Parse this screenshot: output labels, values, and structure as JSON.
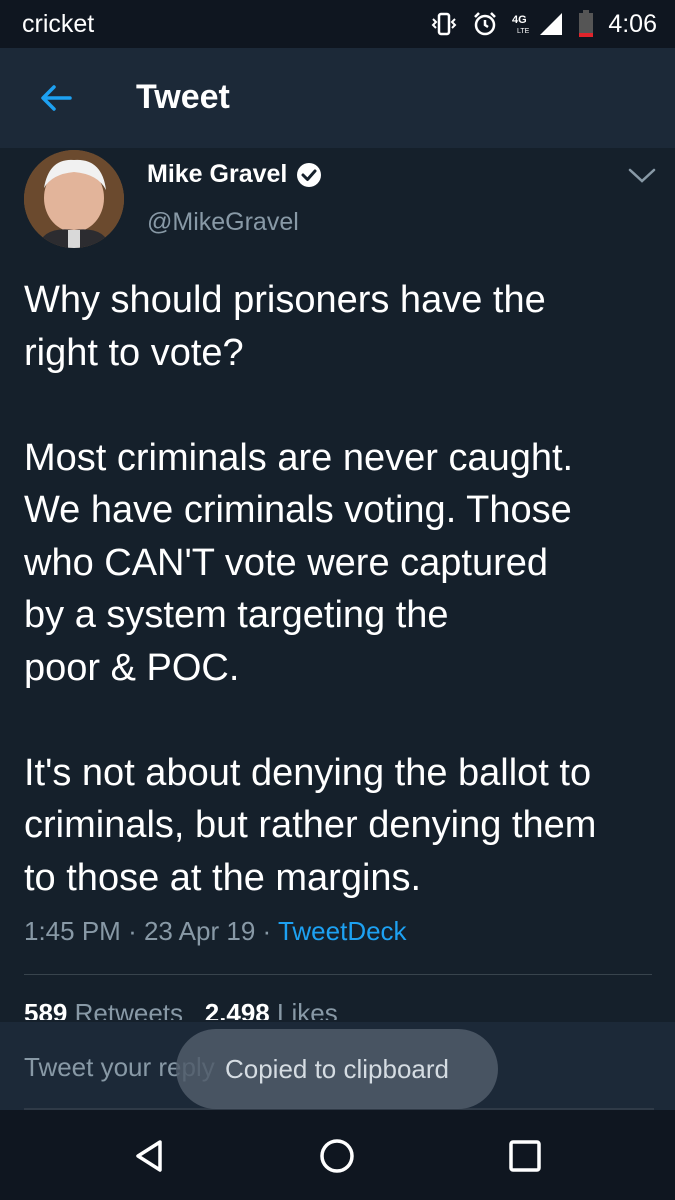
{
  "status_bar": {
    "carrier": "cricket",
    "network": "4G LTE",
    "time": "4:06"
  },
  "header": {
    "title": "Tweet"
  },
  "tweet": {
    "display_name": "Mike Gravel",
    "handle": "@MikeGravel",
    "body": "Why should prisoners have the\nright to vote?\n\nMost criminals are never caught.\nWe have criminals voting. Those\nwho CAN'T vote were captured\nby a system targeting the\npoor & POC.\n\nIt's not about denying the ballot to\ncriminals, but rather denying them\nto those at the margins.",
    "time": "1:45 PM",
    "date": "23 Apr 19",
    "separator": "·",
    "source": "TweetDeck",
    "retweets_count": "589",
    "retweets_label": "Retweets",
    "likes_count": "2,498",
    "likes_label": "Likes"
  },
  "reply": {
    "placeholder": "Tweet your reply"
  },
  "toast": {
    "text": "Copied to clipboard"
  },
  "colors": {
    "background": "#15202b",
    "header": "#1c2938",
    "accent": "#1da1f2",
    "muted": "#8899a6"
  },
  "icons": [
    "vibrate-icon",
    "alarm-icon",
    "signal-icon",
    "battery-icon",
    "back-arrow-icon",
    "verified-badge-icon",
    "chevron-down-icon",
    "nav-back-icon",
    "nav-home-icon",
    "nav-recents-icon"
  ]
}
